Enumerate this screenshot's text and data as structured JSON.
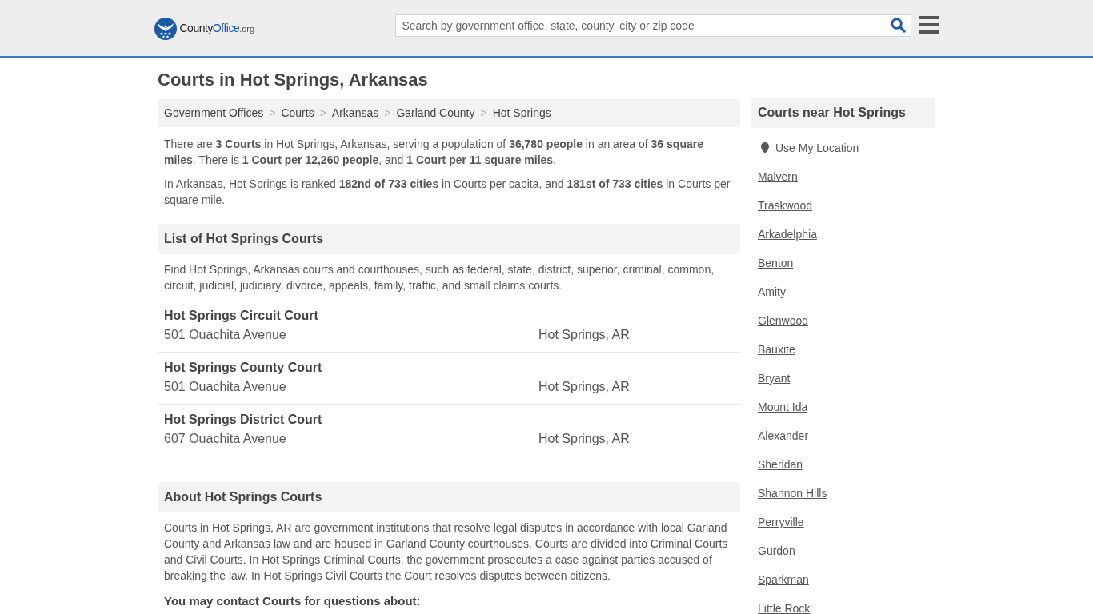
{
  "header": {
    "logo": {
      "part_1": "County",
      "part_2": "Office",
      "suffix": ".org"
    },
    "search": {
      "placeholder": "Search by government office, state, county, city or zip code"
    }
  },
  "page_title": "Courts in Hot Springs, Arkansas",
  "breadcrumbs": {
    "separator": ">",
    "items": [
      "Government Offices",
      "Courts",
      "Arkansas",
      "Garland County",
      "Hot Springs"
    ]
  },
  "intro_paragraphs": [
    "There are **3 Courts** in Hot Springs, Arkansas, serving a population of **36,780 people** in an area of **36 square miles**. There is **1 Court per 12,260 people**, and **1 Court per 11 square miles**.",
    "In Arkansas, Hot Springs is ranked **182nd of 733 cities** in Courts per capita, and **181st of 733 cities** in Courts per square mile."
  ],
  "list_section": {
    "heading": "List of Hot Springs Courts",
    "description": "Find Hot Springs, Arkansas courts and courthouses, such as federal, state, district, superior, criminal, common, circuit, judicial, judiciary, divorce, appeals, family, traffic, and small claims courts.",
    "courts": [
      {
        "name": "Hot Springs Circuit Court",
        "address": "501 Ouachita Avenue",
        "city": "Hot Springs, AR"
      },
      {
        "name": "Hot Springs County Court",
        "address": "501 Ouachita Avenue",
        "city": "Hot Springs, AR"
      },
      {
        "name": "Hot Springs District Court",
        "address": "607 Ouachita Avenue",
        "city": "Hot Springs, AR"
      }
    ]
  },
  "about_section": {
    "heading": "About Hot Springs Courts",
    "paragraph": "Courts in Hot Springs, AR are government institutions that resolve legal disputes in accordance with local Garland County and Arkansas law and are housed in Garland County courthouses. Courts are divided into Criminal Courts and Civil Courts. In Hot Springs Criminal Courts, the government prosecutes a case against parties accused of breaking the law. In Hot Springs Civil Courts the Court resolves disputes between citizens.",
    "subheading": "You may contact Courts for questions about:"
  },
  "sidebar": {
    "heading": "Courts near Hot Springs",
    "location_link": "Use My Location",
    "cities": [
      "Malvern",
      "Traskwood",
      "Arkadelphia",
      "Benton",
      "Amity",
      "Glenwood",
      "Bauxite",
      "Bryant",
      "Mount Ida",
      "Alexander",
      "Sheridan",
      "Shannon Hills",
      "Perryville",
      "Gurdon",
      "Sparkman",
      "Little Rock"
    ]
  }
}
